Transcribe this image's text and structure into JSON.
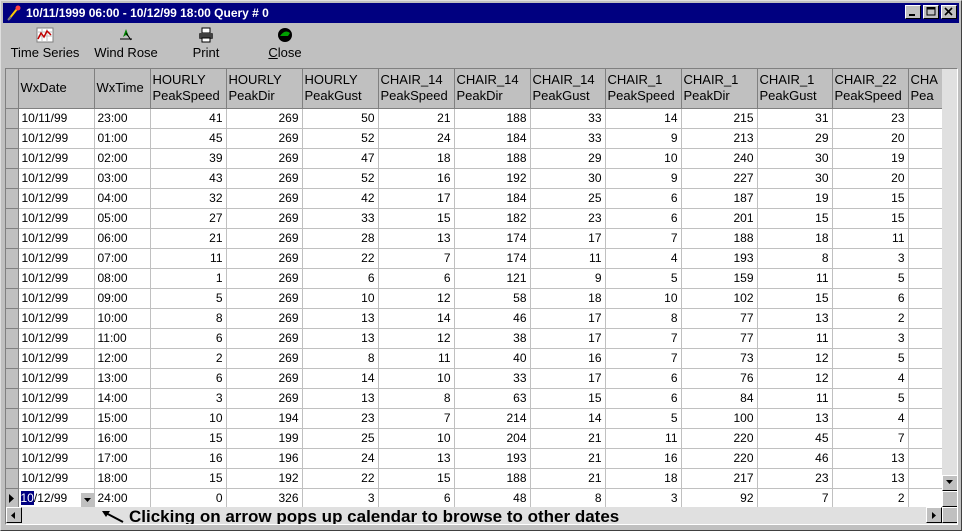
{
  "window": {
    "title": "10/11/1999 06:00 - 10/12/99 18:00 Query # 0"
  },
  "toolbar": {
    "time_series": "Time Series",
    "wind_rose": "Wind Rose",
    "print": "Print",
    "close_first": "C",
    "close_rest": "lose"
  },
  "columns": [
    [
      "WxDate",
      ""
    ],
    [
      "WxTime",
      ""
    ],
    [
      "HOURLY",
      "PeakSpeed"
    ],
    [
      "HOURLY",
      "PeakDir"
    ],
    [
      "HOURLY",
      "PeakGust"
    ],
    [
      "CHAIR_14",
      "PeakSpeed"
    ],
    [
      "CHAIR_14",
      "PeakDir"
    ],
    [
      "CHAIR_14",
      "PeakGust"
    ],
    [
      "CHAIR_1",
      "PeakSpeed"
    ],
    [
      "CHAIR_1",
      "PeakDir"
    ],
    [
      "CHAIR_1",
      "PeakGust"
    ],
    [
      "CHAIR_22",
      "PeakSpeed"
    ],
    [
      "CHA",
      "Pea"
    ]
  ],
  "rows": [
    [
      "10/11/99",
      "23:00",
      "41",
      "269",
      "50",
      "21",
      "188",
      "33",
      "14",
      "215",
      "31",
      "23"
    ],
    [
      "10/12/99",
      "01:00",
      "45",
      "269",
      "52",
      "24",
      "184",
      "33",
      "9",
      "213",
      "29",
      "20"
    ],
    [
      "10/12/99",
      "02:00",
      "39",
      "269",
      "47",
      "18",
      "188",
      "29",
      "10",
      "240",
      "30",
      "19"
    ],
    [
      "10/12/99",
      "03:00",
      "43",
      "269",
      "52",
      "16",
      "192",
      "30",
      "9",
      "227",
      "30",
      "20"
    ],
    [
      "10/12/99",
      "04:00",
      "32",
      "269",
      "42",
      "17",
      "184",
      "25",
      "6",
      "187",
      "19",
      "15"
    ],
    [
      "10/12/99",
      "05:00",
      "27",
      "269",
      "33",
      "15",
      "182",
      "23",
      "6",
      "201",
      "15",
      "15"
    ],
    [
      "10/12/99",
      "06:00",
      "21",
      "269",
      "28",
      "13",
      "174",
      "17",
      "7",
      "188",
      "18",
      "11"
    ],
    [
      "10/12/99",
      "07:00",
      "11",
      "269",
      "22",
      "7",
      "174",
      "11",
      "4",
      "193",
      "8",
      "3"
    ],
    [
      "10/12/99",
      "08:00",
      "1",
      "269",
      "6",
      "6",
      "121",
      "9",
      "5",
      "159",
      "11",
      "5"
    ],
    [
      "10/12/99",
      "09:00",
      "5",
      "269",
      "10",
      "12",
      "58",
      "18",
      "10",
      "102",
      "15",
      "6"
    ],
    [
      "10/12/99",
      "10:00",
      "8",
      "269",
      "13",
      "14",
      "46",
      "17",
      "8",
      "77",
      "13",
      "2"
    ],
    [
      "10/12/99",
      "11:00",
      "6",
      "269",
      "13",
      "12",
      "38",
      "17",
      "7",
      "77",
      "11",
      "3"
    ],
    [
      "10/12/99",
      "12:00",
      "2",
      "269",
      "8",
      "11",
      "40",
      "16",
      "7",
      "73",
      "12",
      "5"
    ],
    [
      "10/12/99",
      "13:00",
      "6",
      "269",
      "14",
      "10",
      "33",
      "17",
      "6",
      "76",
      "12",
      "4"
    ],
    [
      "10/12/99",
      "14:00",
      "3",
      "269",
      "13",
      "8",
      "63",
      "15",
      "6",
      "84",
      "11",
      "5"
    ],
    [
      "10/12/99",
      "15:00",
      "10",
      "194",
      "23",
      "7",
      "214",
      "14",
      "5",
      "100",
      "13",
      "4"
    ],
    [
      "10/12/99",
      "16:00",
      "15",
      "199",
      "25",
      "10",
      "204",
      "21",
      "11",
      "220",
      "45",
      "7"
    ],
    [
      "10/12/99",
      "17:00",
      "16",
      "196",
      "24",
      "13",
      "193",
      "21",
      "16",
      "220",
      "46",
      "13"
    ],
    [
      "10/12/99",
      "18:00",
      "15",
      "192",
      "22",
      "15",
      "188",
      "21",
      "18",
      "217",
      "23",
      "13"
    ]
  ],
  "edit_row": {
    "date_selected": "10",
    "date_rest": "/12/99",
    "values": [
      "24:00",
      "0",
      "326",
      "3",
      "6",
      "48",
      "8",
      "3",
      "92",
      "7",
      "2"
    ]
  },
  "annotation": "Clicking on arrow pops up calendar to browse to other dates"
}
